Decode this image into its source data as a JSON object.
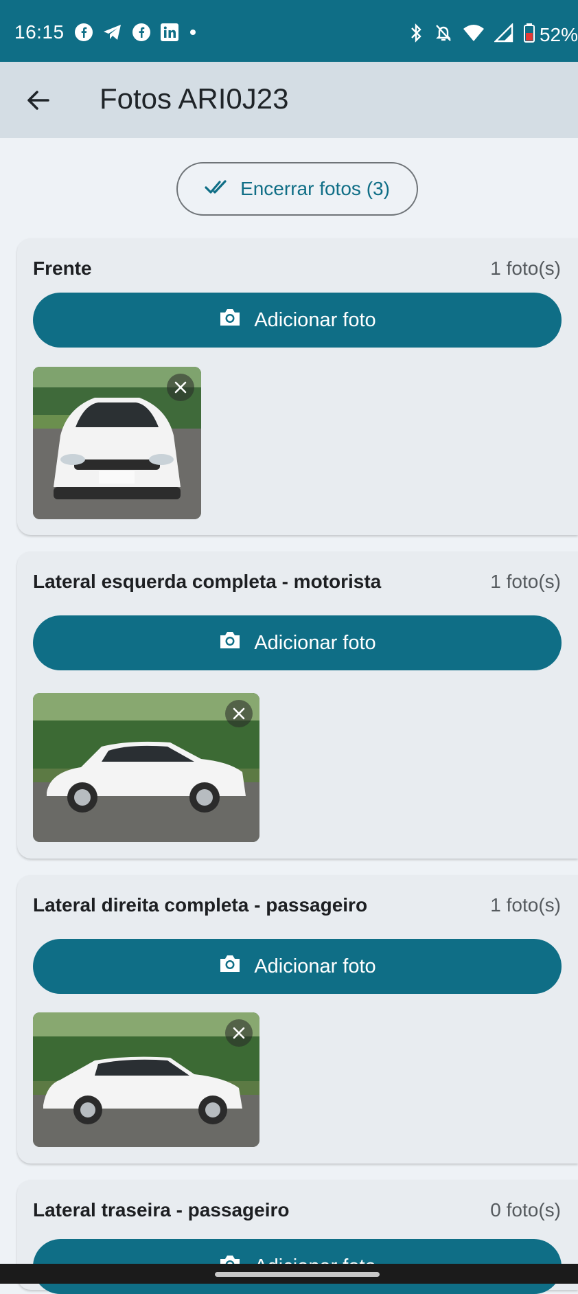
{
  "status_bar": {
    "time": "16:15",
    "notification_icons": [
      "facebook-icon",
      "telegram-icon",
      "facebook-icon",
      "linkedin-icon",
      "dot-icon"
    ],
    "system_icons": [
      "bluetooth-icon",
      "bell-off-icon",
      "wifi-icon",
      "signal-icon",
      "battery-icon"
    ],
    "battery": "52%"
  },
  "app_bar": {
    "back_icon": "arrow-left-icon",
    "title": "Fotos ARI0J23"
  },
  "finish_button": {
    "icon": "double-check-icon",
    "label": "Encerrar fotos (3)"
  },
  "sections": [
    {
      "name": "Frente",
      "count": "1 foto(s)",
      "add_label": "Adicionar foto",
      "photos": [
        {
          "subject": "car-front-photo"
        }
      ]
    },
    {
      "name": "Lateral esquerda completa - motorista",
      "count": "1 foto(s)",
      "add_label": "Adicionar foto",
      "photos": [
        {
          "subject": "car-left-side-photo"
        }
      ]
    },
    {
      "name": "Lateral direita completa - passageiro",
      "count": "1 foto(s)",
      "add_label": "Adicionar foto",
      "photos": [
        {
          "subject": "car-right-side-photo"
        }
      ]
    },
    {
      "name": "Lateral traseira - passageiro",
      "count": "0 foto(s)",
      "add_label": "Adicionar foto",
      "photos": []
    }
  ],
  "colors": {
    "primary": "#0f6e86",
    "background": "#eef2f6",
    "app_bar": "#d4dde4",
    "card": "#e8ecf0"
  }
}
